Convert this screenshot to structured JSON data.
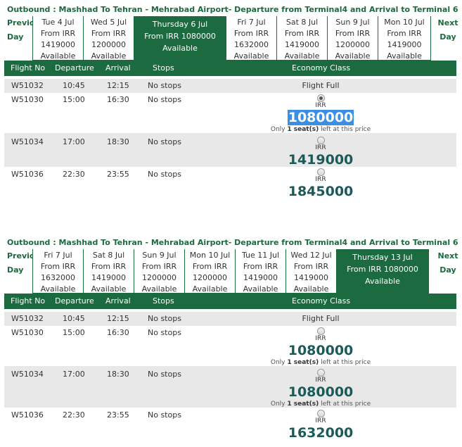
{
  "sections": [
    {
      "title": "Outbound : Mashhad To Tehran - Mehrabad Airport- Departure from Terminal4 and Arrival to Terminal 6",
      "prev_label": [
        "Previous",
        "Day"
      ],
      "next_label": [
        "Next",
        "Day"
      ],
      "days": [
        {
          "lines": [
            "Tue 4 Jul",
            "From IRR",
            "1419000",
            "Available"
          ]
        },
        {
          "lines": [
            "Wed 5 Jul",
            "From IRR",
            "1200000",
            "Available"
          ]
        },
        {
          "lines": [
            "Thursday 6 Jul",
            "From IRR 1080000",
            "Available"
          ],
          "selected": true
        },
        {
          "lines": [
            "Fri 7 Jul",
            "From IRR",
            "1632000",
            "Available"
          ]
        },
        {
          "lines": [
            "Sat 8 Jul",
            "From IRR",
            "1419000",
            "Available"
          ]
        },
        {
          "lines": [
            "Sun 9 Jul",
            "From IRR",
            "1200000",
            "Available"
          ]
        },
        {
          "lines": [
            "Mon 10 Jul",
            "From IRR",
            "1419000",
            "Available"
          ]
        }
      ],
      "headers": {
        "flight_no": "Flight No",
        "departure": "Departure",
        "arrival": "Arrival",
        "stops": "Stops",
        "economy": "Economy Class"
      },
      "rows": [
        {
          "flight": "W51032",
          "dep": "10:45",
          "arr": "12:15",
          "stops": "No stops",
          "status": "Flight Full"
        },
        {
          "flight": "W51030",
          "dep": "15:00",
          "arr": "16:30",
          "stops": "No stops",
          "currency": "IRR",
          "price": "1080000",
          "note_pre": "Only",
          "note_seats": "1 seat(s)",
          "note_post": "left at this price",
          "checked": true,
          "highlight": true
        },
        {
          "flight": "W51034",
          "dep": "17:00",
          "arr": "18:30",
          "stops": "No stops",
          "currency": "IRR",
          "price": "1419000"
        },
        {
          "flight": "W51036",
          "dep": "22:30",
          "arr": "23:55",
          "stops": "No stops",
          "currency": "IRR",
          "price": "1845000"
        }
      ]
    },
    {
      "title": "Outbound : Mashhad To Tehran - Mehrabad Airport- Departure from Terminal4 and Arrival to Terminal 6",
      "prev_label": [
        "Previous",
        "Day"
      ],
      "next_label": [
        "Next",
        "Day"
      ],
      "days": [
        {
          "lines": [
            "Fri 7 Jul",
            "From IRR",
            "1632000",
            "Available"
          ]
        },
        {
          "lines": [
            "Sat 8 Jul",
            "From IRR",
            "1419000",
            "Available"
          ]
        },
        {
          "lines": [
            "Sun 9 Jul",
            "From IRR",
            "1200000",
            "Available"
          ]
        },
        {
          "lines": [
            "Mon 10 Jul",
            "From IRR",
            "1200000",
            "Available"
          ]
        },
        {
          "lines": [
            "Tue 11 Jul",
            "From IRR",
            "1419000",
            "Available"
          ]
        },
        {
          "lines": [
            "Wed 12 Jul",
            "From IRR",
            "1419000",
            "Available"
          ]
        },
        {
          "lines": [
            "Thursday 13 Jul",
            "From IRR 1080000",
            "Available"
          ],
          "selected": true
        }
      ],
      "headers": {
        "flight_no": "Flight No",
        "departure": "Departure",
        "arrival": "Arrival",
        "stops": "Stops",
        "economy": "Economy Class"
      },
      "rows": [
        {
          "flight": "W51032",
          "dep": "10:45",
          "arr": "12:15",
          "stops": "No stops",
          "status": "Flight Full"
        },
        {
          "flight": "W51030",
          "dep": "15:00",
          "arr": "16:30",
          "stops": "No stops",
          "currency": "IRR",
          "price": "1080000",
          "note_pre": "Only",
          "note_seats": "1 seat(s)",
          "note_post": "left at this price"
        },
        {
          "flight": "W51034",
          "dep": "17:00",
          "arr": "18:30",
          "stops": "No stops",
          "currency": "IRR",
          "price": "1080000",
          "note_pre": "Only",
          "note_seats": "1 seat(s)",
          "note_post": "left at this price"
        },
        {
          "flight": "W51036",
          "dep": "22:30",
          "arr": "23:55",
          "stops": "No stops",
          "currency": "IRR",
          "price": "1632000"
        }
      ]
    }
  ],
  "colors": {
    "brand_green": "#1c6a3f",
    "price_teal": "#1c5a5a",
    "row_shade": "#e8e8e8",
    "selection_blue": "#3a8ee6"
  }
}
